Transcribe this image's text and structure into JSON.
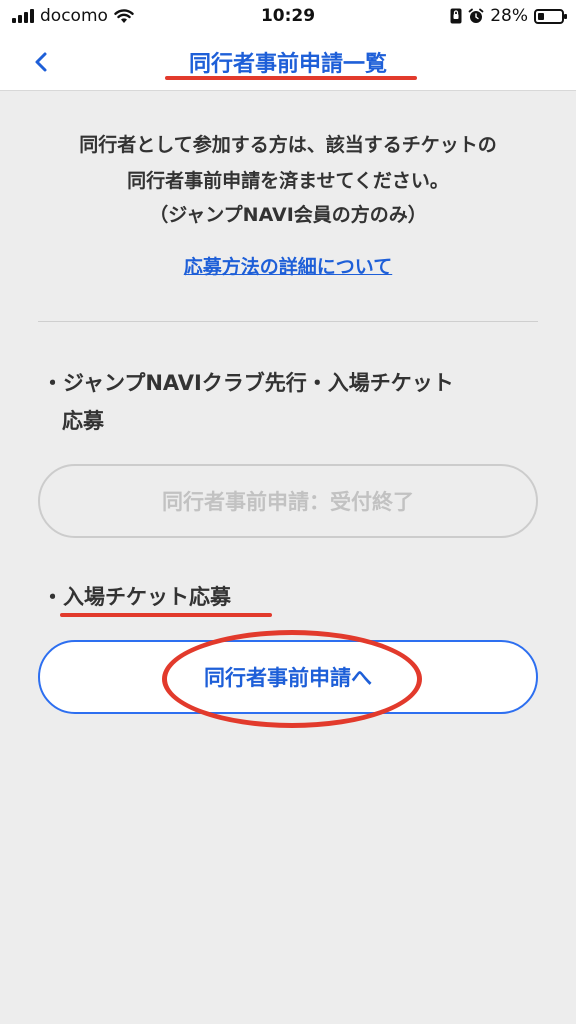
{
  "status_bar": {
    "carrier": "docomo",
    "time": "10:29",
    "battery_percent_label": "28%",
    "battery_level": 0.28,
    "icons": [
      "signal-bars-icon",
      "wifi-icon",
      "portrait-lock-icon",
      "alarm-icon",
      "battery-icon"
    ]
  },
  "header": {
    "back_icon": "chevron-left-icon",
    "title": "同行者事前申請一覧"
  },
  "notice": {
    "line1": "同行者として参加する方は、該当するチケットの",
    "line2": "同行者事前申請を済ませてください。",
    "line3": "（ジャンプNAVI会員の方のみ）"
  },
  "details_link": "応募方法の詳細について",
  "sections": [
    {
      "title_line1": "・ジャンプNAVIクラブ先行・入場チケット",
      "title_line2": "応募",
      "button_label": "同行者事前申請：受付終了",
      "button_state": "disabled"
    },
    {
      "title_line1": "・入場チケット応募",
      "button_label": "同行者事前申請へ",
      "button_state": "active"
    }
  ],
  "colors": {
    "accent_blue": "#1e5fd8",
    "annotation_red": "#e23a2c",
    "background": "#ededed"
  }
}
